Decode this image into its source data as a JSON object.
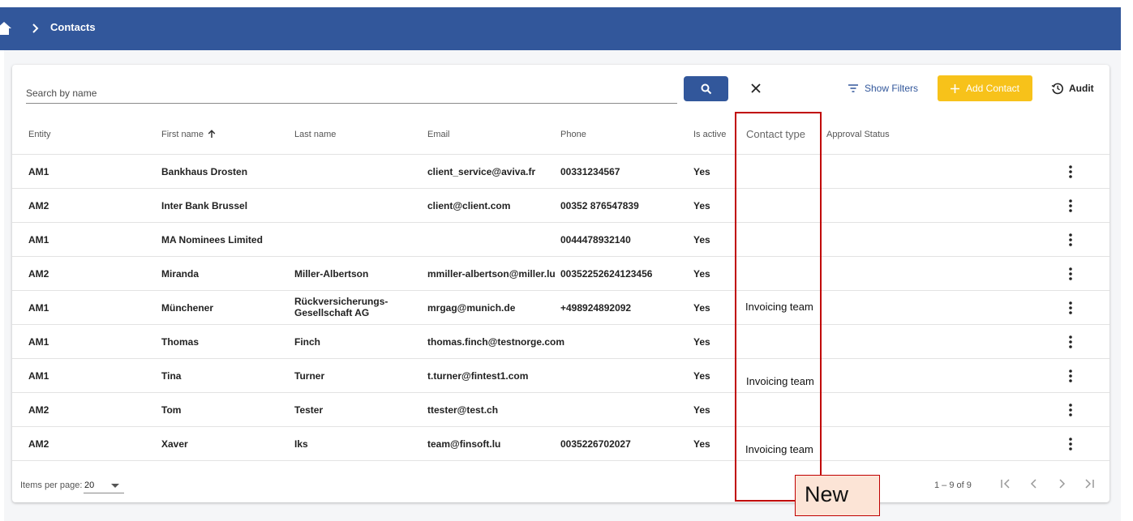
{
  "header": {
    "breadcrumb_current": "Contacts"
  },
  "toolbar": {
    "search_placeholder": "Search by name",
    "show_filters_label": "Show Filters",
    "add_contact_label": "Add Contact",
    "audit_label": "Audit"
  },
  "table": {
    "columns": [
      "Entity",
      "First name",
      "Last name",
      "Email",
      "Phone",
      "Is active",
      "Contact type",
      "Approval Status"
    ],
    "rows": [
      {
        "entity": "AM1",
        "first": "Bankhaus Drosten",
        "last": "",
        "email": "client_service@aviva.fr",
        "phone": "00331234567",
        "active": "Yes",
        "contact_type": "",
        "approval": ""
      },
      {
        "entity": "AM2",
        "first": "Inter Bank Brussel",
        "last": "",
        "email": "client@client.com",
        "phone": "00352 876547839",
        "active": "Yes",
        "contact_type": "",
        "approval": ""
      },
      {
        "entity": "AM1",
        "first": "MA Nominees Limited",
        "last": "",
        "email": "",
        "phone": "0044478932140",
        "active": "Yes",
        "contact_type": "",
        "approval": ""
      },
      {
        "entity": "AM2",
        "first": "Miranda",
        "last": "Miller-Albertson",
        "email": "mmiller-albertson@miller.lu",
        "phone": "00352252624123456",
        "active": "Yes",
        "contact_type": "",
        "approval": ""
      },
      {
        "entity": "AM1",
        "first": "Münchener",
        "last": "Rückversicherungs-",
        "last2": "Gesellschaft AG",
        "email": "mrgag@munich.de",
        "phone": "+498924892092",
        "active": "Yes",
        "contact_type": "Invoicing team",
        "approval": ""
      },
      {
        "entity": "AM1",
        "first": "Thomas",
        "last": "Finch",
        "email": "thomas.finch@testnorge.com",
        "phone": "",
        "active": "Yes",
        "contact_type": "",
        "approval": ""
      },
      {
        "entity": "AM1",
        "first": "Tina",
        "last": "Turner",
        "email": "t.turner@fintest1.com",
        "phone": "",
        "active": "Yes",
        "contact_type": "Invoicing team",
        "approval": ""
      },
      {
        "entity": "AM2",
        "first": "Tom",
        "last": "Tester",
        "email": "ttester@test.ch",
        "phone": "",
        "active": "Yes",
        "contact_type": "",
        "approval": ""
      },
      {
        "entity": "AM2",
        "first": "Xaver",
        "last": "Iks",
        "email": "team@finsoft.lu",
        "phone": "0035226702027",
        "active": "Yes",
        "contact_type": "Invoicing team",
        "approval": ""
      }
    ]
  },
  "paginator": {
    "items_per_page_label": "Items per page:",
    "items_per_page_value": "20",
    "range_label": "1 – 9 of 9"
  },
  "annotation": {
    "callout_text": "New",
    "color": "#c00000"
  },
  "colors": {
    "primary": "#32579b",
    "accent": "#f7c21a"
  }
}
